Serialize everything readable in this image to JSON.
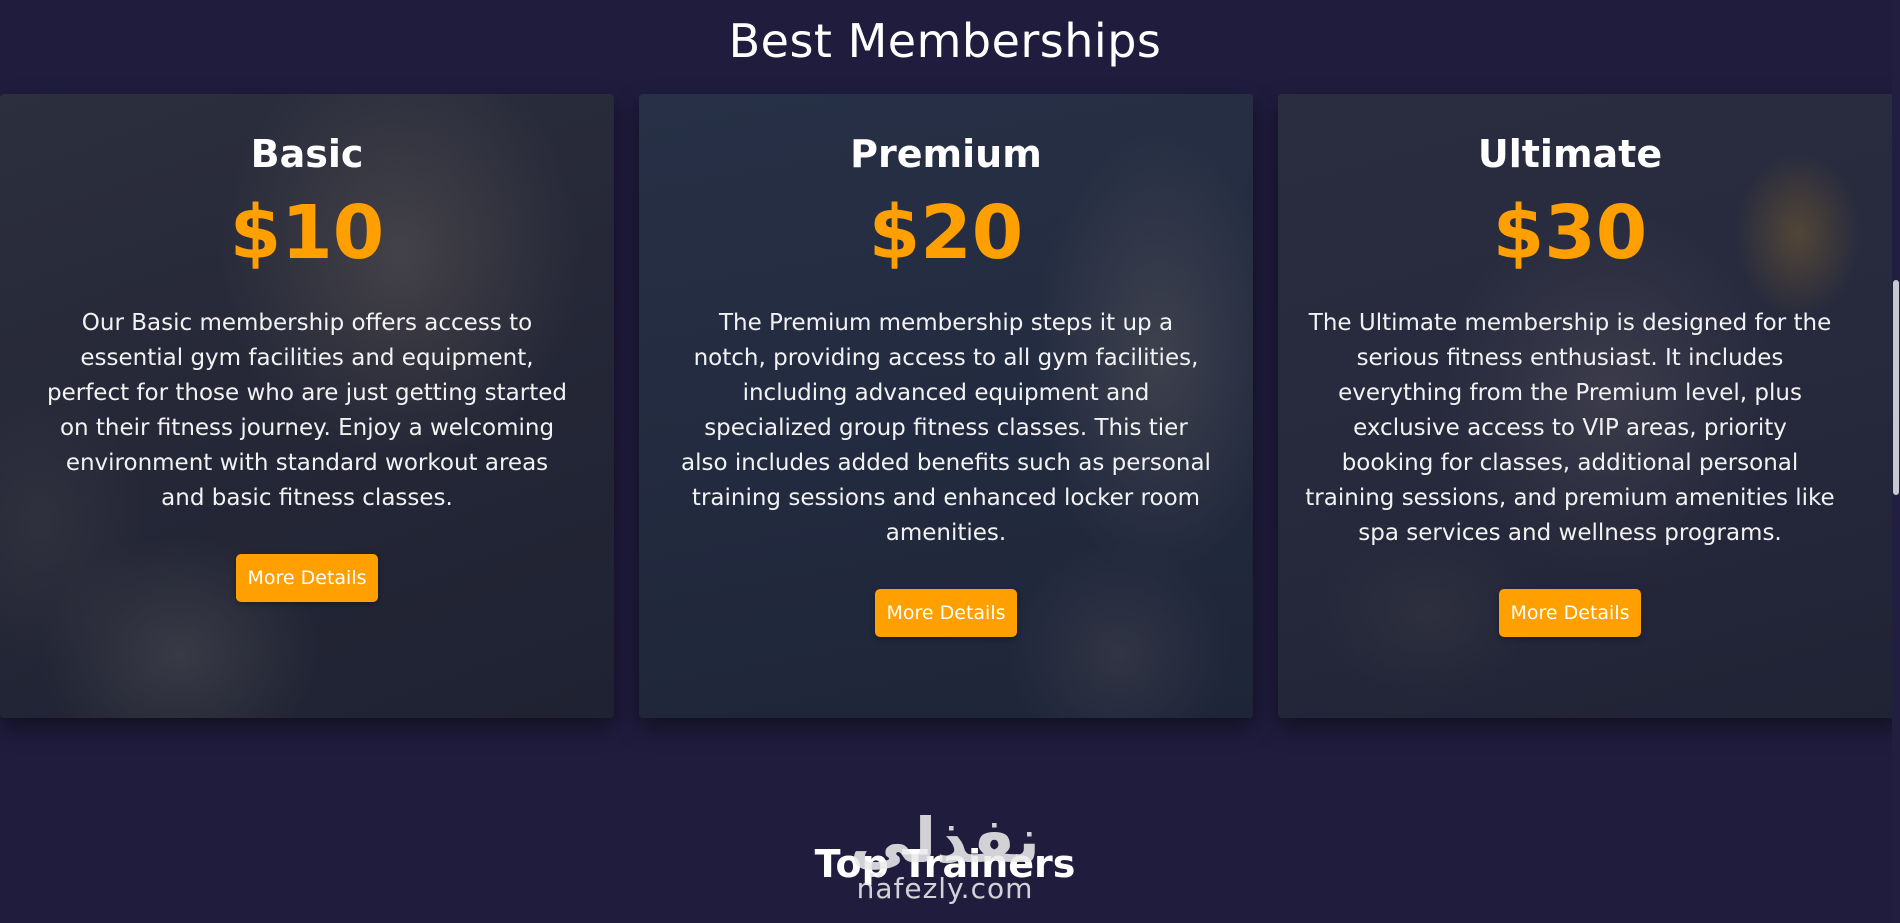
{
  "section": {
    "title": "Best Memberships"
  },
  "plans": [
    {
      "name": "Basic",
      "price": "$10",
      "description": "Our Basic membership offers access to essential gym facilities and equipment, perfect for those who are just getting started on their fitness journey. Enjoy a welcoming environment with standard workout areas and basic fitness classes.",
      "button_label": "More Details"
    },
    {
      "name": "Premium",
      "price": "$20",
      "description": "The Premium membership steps it up a notch, providing access to all gym facilities, including advanced equipment and specialized group fitness classes. This tier also includes added benefits such as personal training sessions and enhanced locker room amenities.",
      "button_label": "More Details"
    },
    {
      "name": "Ultimate",
      "price": "$30",
      "description": "The Ultimate membership is designed for the serious fitness enthusiast. It includes everything from the Premium level, plus exclusive access to VIP areas, priority booking for classes, additional personal training sessions, and premium amenities like spa services and wellness programs.",
      "button_label": "More Details"
    }
  ],
  "trainers": {
    "title": "Top Trainers",
    "subtitle": ""
  },
  "watermark": {
    "logo_text": "نفذلي",
    "url": "nafezly.com"
  },
  "colors": {
    "background": "#201c3e",
    "accent": "#ffa000",
    "price": "#ff9f00"
  }
}
